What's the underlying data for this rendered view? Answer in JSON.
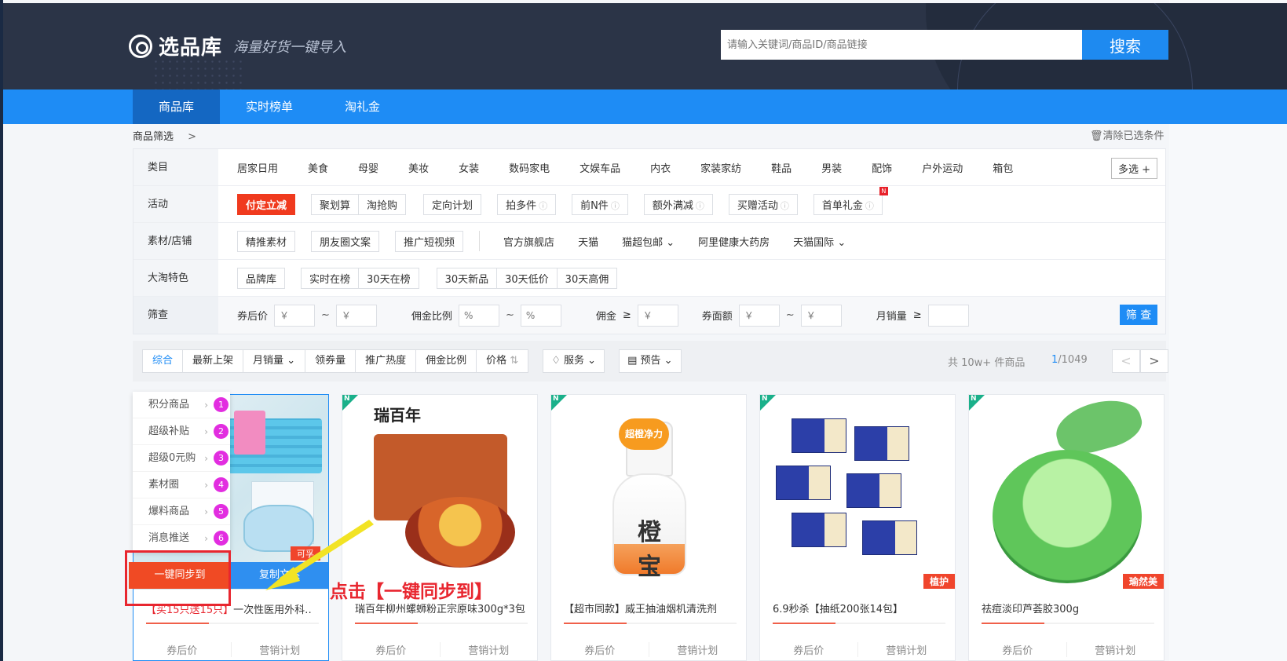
{
  "header": {
    "logo_text": "选品库",
    "slogan": "海量好货一键导入",
    "search_placeholder": "请输入关键词/商品ID/商品链接",
    "search_button": "搜索"
  },
  "nav": {
    "items": [
      {
        "label": "商品库"
      },
      {
        "label": "实时榜单"
      },
      {
        "label": "淘礼金"
      }
    ]
  },
  "breadcrumb": {
    "label": "商品筛选",
    "chevron": ">"
  },
  "clear_filters": "清除已选条件",
  "filters": {
    "category": {
      "label": "类目",
      "items": [
        "居家日用",
        "美食",
        "母婴",
        "美妆",
        "女装",
        "数码家电",
        "文娱车品",
        "内衣",
        "家装家纺",
        "鞋品",
        "男装",
        "配饰",
        "户外运动",
        "箱包"
      ],
      "multi": "多选 +"
    },
    "activity": {
      "label": "活动",
      "items": [
        "付定立减",
        "聚划算",
        "淘抢购",
        "定向计划",
        "拍多件",
        "前N件",
        "额外满减",
        "买赠活动",
        "首单礼金"
      ],
      "new_badge": "N"
    },
    "material": {
      "label": "素材/店铺",
      "tags": [
        "精推素材",
        "朋友圈文案",
        "推广短视频"
      ],
      "plain": [
        "官方旗舰店",
        "天猫",
        "猫超包邮",
        "阿里健康大药房",
        "天猫国际"
      ]
    },
    "feature": {
      "label": "大淘特色",
      "tags": [
        "品牌库",
        "实时在榜",
        "30天在榜",
        "30天新品",
        "30天低价",
        "30天高佣"
      ]
    },
    "sift": {
      "label": "筛查",
      "price_label": "券后价",
      "commission_rate_label": "佣金比例",
      "commission_label": "佣金",
      "coupon_label": "券面额",
      "monthly_sales_label": "月销量",
      "yen": "￥",
      "percent": "%",
      "gte": "≥",
      "tilde": "~",
      "button": "筛 查"
    }
  },
  "sort": {
    "items": [
      "综合",
      "最新上架",
      "月销量",
      "领券量",
      "推广热度",
      "佣金比例",
      "价格"
    ],
    "service": "服务",
    "presale": "预告",
    "total_prefix": "共 10w+ 件商品",
    "page_current": "1",
    "page_total": "/1049",
    "prev": "<",
    "next": ">"
  },
  "sync_menu": {
    "items": [
      {
        "label": "积分商品",
        "num": "1"
      },
      {
        "label": "超级补贴",
        "num": "2"
      },
      {
        "label": "超级0元购",
        "num": "3"
      },
      {
        "label": "素材圈",
        "num": "4"
      },
      {
        "label": "爆料商品",
        "num": "5"
      },
      {
        "label": "消息推送",
        "num": "6"
      }
    ],
    "sync_button": "一键同步到",
    "copy_button": "复制文案"
  },
  "annotation": "点击【一键同步到】",
  "products": [
    {
      "title_hl": "【买15只送15只】",
      "title": "一次性医用外科…",
      "brand": "可孚",
      "coupon": "券后价",
      "plan": "营销计划"
    },
    {
      "title": "瑞百年柳州螺蛳粉正宗原味300g*3包",
      "brand_text": "瑞百年",
      "coupon": "券后价",
      "plan": "营销计划"
    },
    {
      "title": "【超市同款】威王抽油烟机清洗剂",
      "bottle_label": "橙宝",
      "bottle_tag": "超橙净力",
      "coupon": "券后价",
      "plan": "营销计划"
    },
    {
      "title": "6.9秒杀【抽纸200张14包】",
      "brand": "植护",
      "coupon": "券后价",
      "plan": "营销计划"
    },
    {
      "title": "祛痘淡印芦荟胶300g",
      "brand": "瑜然美",
      "coupon": "券后价",
      "plan": "营销计划"
    }
  ],
  "colors": {
    "primary": "#1e8cf5",
    "nav_active": "#1467c2",
    "header_bg": "#2b3447",
    "accent_red": "#e8262f",
    "badge_magenta": "#e22de0"
  }
}
